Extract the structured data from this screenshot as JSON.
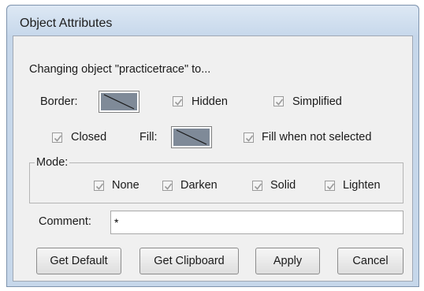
{
  "window": {
    "title": "Object Attributes"
  },
  "header_text": "Changing object \"practicetrace\" to...",
  "border": {
    "label": "Border:"
  },
  "checkboxes": {
    "hidden": {
      "label": "Hidden",
      "checked": true
    },
    "simplified": {
      "label": "Simplified",
      "checked": true
    },
    "closed": {
      "label": "Closed",
      "checked": true
    },
    "fill_when_not_selected": {
      "label": "Fill when not selected",
      "checked": true
    }
  },
  "fill": {
    "label": "Fill:"
  },
  "mode": {
    "label": "Mode:",
    "options": {
      "none": {
        "label": "None",
        "checked": true
      },
      "darken": {
        "label": "Darken",
        "checked": true
      },
      "solid": {
        "label": "Solid",
        "checked": true
      },
      "lighten": {
        "label": "Lighten",
        "checked": true
      }
    }
  },
  "comment": {
    "label": "Comment:",
    "value": "*"
  },
  "buttons": {
    "get_default": "Get Default",
    "get_clipboard": "Get Clipboard",
    "apply": "Apply",
    "cancel": "Cancel"
  },
  "colors": {
    "swatch_fill": "#7f8a98",
    "checkmark": "#9a9a9a",
    "titlebar": "#c6d7ea"
  }
}
